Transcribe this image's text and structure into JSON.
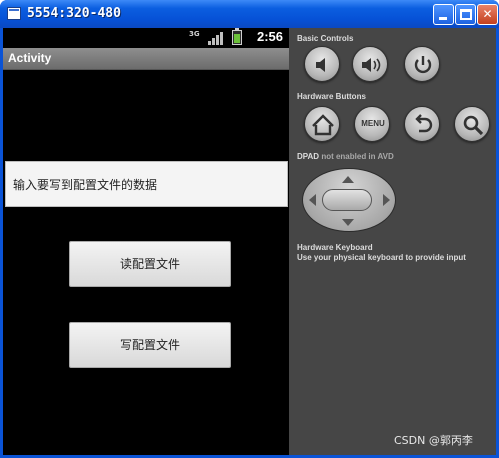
{
  "window": {
    "title": "5554:320-480"
  },
  "status_bar": {
    "network": "3G",
    "time": "2:56"
  },
  "app_bar": {
    "title": "Activity"
  },
  "edit_text": {
    "value": "输入要写到配置文件的数据"
  },
  "buttons": {
    "read": "读配置文件",
    "write": "写配置文件"
  },
  "controls": {
    "basic_label": "Basic Controls",
    "hardware_label": "Hardware Buttons",
    "menu_label": "MENU",
    "dpad_label": "DPAD",
    "dpad_note": "not enabled in AVD",
    "keyboard_label": "Hardware Keyboard",
    "keyboard_note": "Use your physical keyboard to provide input"
  },
  "icons": {
    "basic": [
      "volume-down-icon",
      "volume-up-icon",
      "power-icon"
    ],
    "hardware": [
      "home-icon",
      "menu-icon",
      "back-icon",
      "search-icon"
    ]
  },
  "watermark": "CSDN @郭丙李"
}
